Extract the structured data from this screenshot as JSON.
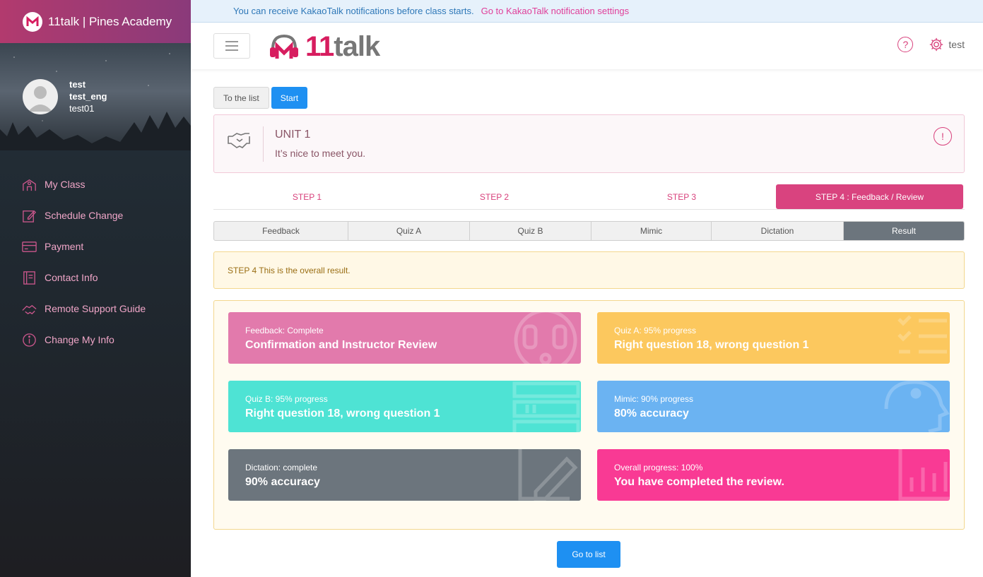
{
  "sidebar": {
    "brand": "11talk | Pines Academy",
    "user": {
      "name": "test",
      "name_eng": "test_eng",
      "id": "test01"
    },
    "items": [
      {
        "label": "My Class",
        "icon": "school-icon"
      },
      {
        "label": "Schedule Change",
        "icon": "edit-icon"
      },
      {
        "label": "Payment",
        "icon": "card-icon"
      },
      {
        "label": "Contact Info",
        "icon": "book-icon"
      },
      {
        "label": "Remote Support Guide",
        "icon": "handshake-icon"
      },
      {
        "label": "Change My Info",
        "icon": "info-icon"
      }
    ]
  },
  "notice": {
    "message": "You can receive KakaoTalk notifications before class starts.",
    "link": "Go to KakaoTalk notification settings"
  },
  "header": {
    "logo_text_a": "11",
    "logo_text_b": "talk",
    "help": "?",
    "user": "test"
  },
  "actions": {
    "to_list": "To the list",
    "start": "Start",
    "go_to_list": "Go to list"
  },
  "unit": {
    "title": "UNIT 1",
    "subtitle": "It’s nice to meet you.",
    "info": "!"
  },
  "steps": [
    {
      "label": "STEP 1"
    },
    {
      "label": "STEP 2"
    },
    {
      "label": "STEP 3"
    },
    {
      "label": "STEP 4 : Feedback / Review",
      "active": true
    }
  ],
  "subtabs": [
    {
      "label": "Feedback"
    },
    {
      "label": "Quiz A"
    },
    {
      "label": "Quiz B"
    },
    {
      "label": "Mimic"
    },
    {
      "label": "Dictation"
    },
    {
      "label": "Result",
      "active": true
    }
  ],
  "alert": "STEP 4 This is the overall result.",
  "cards": [
    {
      "label": "Feedback: Complete",
      "value": "Confirmation and Instructor Review",
      "color": "#e27aac",
      "icon": "face-icon"
    },
    {
      "label": "Quiz A: 95% progress",
      "value": "Right question 18, wrong question 1",
      "color": "#fcc85e",
      "icon": "checklist-icon"
    },
    {
      "label": "Quiz B: 95% progress",
      "value": "Right question 18, wrong question 1",
      "color": "#4ee3d4",
      "icon": "list-icon"
    },
    {
      "label": "Mimic: 90% progress",
      "value": "80% accuracy",
      "color": "#6bb3f2",
      "icon": "head-icon"
    },
    {
      "label": "Dictation: complete",
      "value": "90% accuracy",
      "color": "#6c757d",
      "icon": "pencil-icon"
    },
    {
      "label": "Overall progress: 100%",
      "value": "You have completed the review.",
      "color": "#f93a94",
      "icon": "bar-chart-icon"
    }
  ]
}
